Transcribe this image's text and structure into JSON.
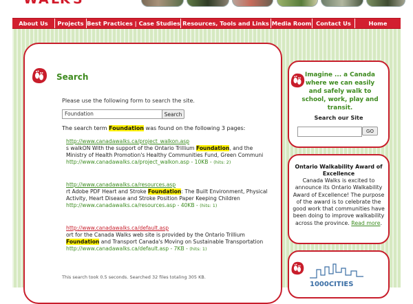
{
  "nav": {
    "items": [
      {
        "label": "About Us"
      },
      {
        "label": "Projects"
      },
      {
        "label": "Best Practices | Case Studies"
      },
      {
        "label": "Resources, Tools and Links"
      },
      {
        "label": "Media Room"
      },
      {
        "label": "Contact Us"
      },
      {
        "label": "Home"
      }
    ]
  },
  "colors": {
    "brand_red": "#d21f2f",
    "brand_green": "#3d8a1e",
    "highlight": "#fff200",
    "background_green": "#d6e9c1"
  },
  "main": {
    "title": "Search",
    "intro": "Please use the following form to search the site.",
    "search": {
      "value": "Foundation",
      "button_label": "Search"
    },
    "summary": {
      "before": "The search term ",
      "term": "Foundation",
      "after": " was found on the following 3 pages:"
    },
    "results": [
      {
        "url": "http://www.canadawalks.ca/project_walkon.asp",
        "snippet_before": "s walkON With the support of the Ontario Trillium ",
        "snippet_term": "Foundation",
        "snippet_after": ", and the Ministry of Health Promotion's Healthy Communities Fund, Green Communi",
        "meta": "http://www.canadawalks.ca/project_walkon.asp - 10KB - ",
        "hits": "(hits: 2)"
      },
      {
        "url": "http://www.canadawalks.ca/resources.asp",
        "snippet_before": "rt Adobe PDF Heart and Stroke ",
        "snippet_term": "Foundation",
        "snippet_after": ": The Built Environment, Physical Activity, Heart Disease and Stroke Position Paper Keeping Children",
        "meta": "http://www.canadawalks.ca/resources.asp - 40KB - ",
        "hits": "(hits: 1)"
      },
      {
        "url": "http://www.canadawalks.ca/default.asp",
        "snippet_before": "ort for the Canada Walks web site is provided by the Ontario Trillium ",
        "snippet_term": "Foundation",
        "snippet_after": " and Transport Canada's Moving on Sustainable Transportation",
        "meta": "http://www.canadawalks.ca/default.asp - 7KB - ",
        "hits": "(hits: 1)"
      }
    ],
    "footer_note": "This search took 0.5 seconds. Searched 32 files totaling 305 KB."
  },
  "sidebar": {
    "tagline": "Imagine ... a Canada where we can easily and safely walk to school, work, play and transit.",
    "search_title": "Search our Site",
    "go_label": "GO",
    "award": {
      "title": "Ontario Walkability Award of Excellence",
      "text": "Canada Walks is excited to announce its Ontario Walkability Award of Excellence! The purpose of the award is to celebrate the good work that communities have been doing to improve walkability across the province. ",
      "more_label": "Read more",
      "more_suffix": "."
    },
    "logo_text": "1000CITIES"
  }
}
